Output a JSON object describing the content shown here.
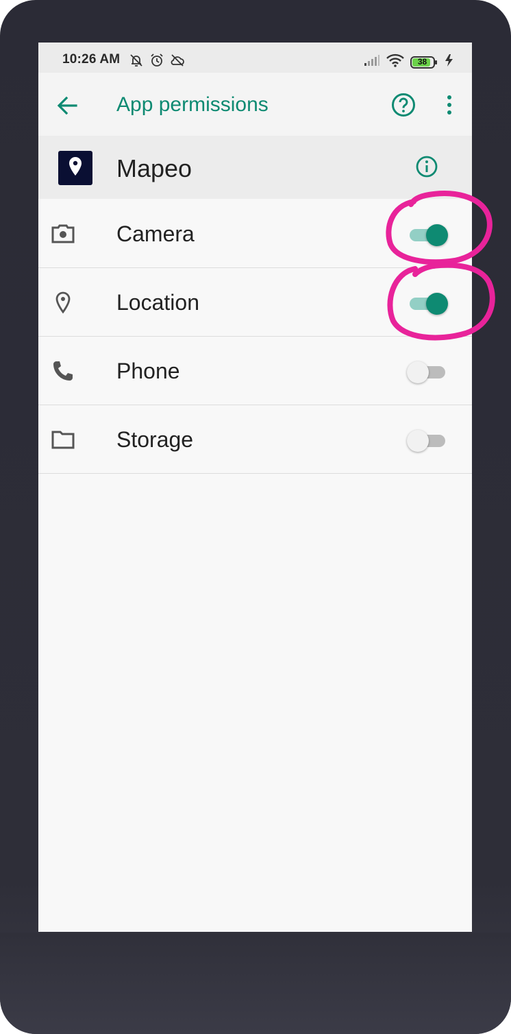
{
  "status_bar": {
    "time": "10:26 AM",
    "battery_level": "38",
    "icons_left": [
      "bell-off-icon",
      "alarm-icon",
      "cloud-off-icon"
    ],
    "icons_right": [
      "signal-icon",
      "wifi-icon",
      "battery-icon",
      "charging-icon"
    ]
  },
  "app_bar": {
    "title": "App permissions",
    "accent_color": "#0e8a72"
  },
  "app": {
    "name": "Mapeo",
    "icon_bg": "#0a0f33"
  },
  "permissions": [
    {
      "label": "Camera",
      "icon": "camera-icon",
      "enabled": true
    },
    {
      "label": "Location",
      "icon": "location-pin-icon",
      "enabled": true
    },
    {
      "label": "Phone",
      "icon": "phone-icon",
      "enabled": false
    },
    {
      "label": "Storage",
      "icon": "folder-icon",
      "enabled": false
    }
  ],
  "annotation_color": "#e8239a"
}
